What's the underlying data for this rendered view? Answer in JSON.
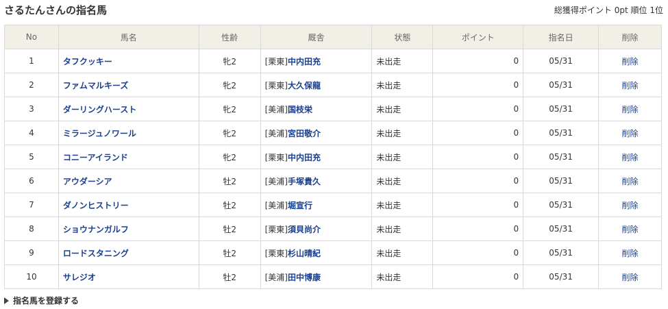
{
  "header": {
    "title": "さるたんさんの指名馬",
    "summary_label": "総獲得ポイント",
    "points": "0pt",
    "rank_label": "順位",
    "rank": "1位"
  },
  "table": {
    "columns": [
      "No",
      "馬名",
      "性齢",
      "厩舎",
      "状態",
      "ポイント",
      "指名日",
      "削除"
    ],
    "rows": [
      {
        "no": "1",
        "name": "タフクッキー",
        "sex_age": "牝2",
        "region": "[栗東]",
        "trainer": "中内田充",
        "status": "未出走",
        "point": "0",
        "date": "05/31",
        "delete": "削除"
      },
      {
        "no": "2",
        "name": "ファムマルキーズ",
        "sex_age": "牝2",
        "region": "[栗東]",
        "trainer": "大久保龍",
        "status": "未出走",
        "point": "0",
        "date": "05/31",
        "delete": "削除"
      },
      {
        "no": "3",
        "name": "ダーリングハースト",
        "sex_age": "牝2",
        "region": "[美浦]",
        "trainer": "国枝栄",
        "status": "未出走",
        "point": "0",
        "date": "05/31",
        "delete": "削除"
      },
      {
        "no": "4",
        "name": "ミラージュノワール",
        "sex_age": "牝2",
        "region": "[美浦]",
        "trainer": "宮田敬介",
        "status": "未出走",
        "point": "0",
        "date": "05/31",
        "delete": "削除"
      },
      {
        "no": "5",
        "name": "コニーアイランド",
        "sex_age": "牝2",
        "region": "[栗東]",
        "trainer": "中内田充",
        "status": "未出走",
        "point": "0",
        "date": "05/31",
        "delete": "削除"
      },
      {
        "no": "6",
        "name": "アウダーシア",
        "sex_age": "牡2",
        "region": "[美浦]",
        "trainer": "手塚貴久",
        "status": "未出走",
        "point": "0",
        "date": "05/31",
        "delete": "削除"
      },
      {
        "no": "7",
        "name": "ダノンヒストリー",
        "sex_age": "牡2",
        "region": "[美浦]",
        "trainer": "堀宣行",
        "status": "未出走",
        "point": "0",
        "date": "05/31",
        "delete": "削除"
      },
      {
        "no": "8",
        "name": "ショウナンガルフ",
        "sex_age": "牡2",
        "region": "[栗東]",
        "trainer": "須貝尚介",
        "status": "未出走",
        "point": "0",
        "date": "05/31",
        "delete": "削除"
      },
      {
        "no": "9",
        "name": "ロードスタニング",
        "sex_age": "牡2",
        "region": "[栗東]",
        "trainer": "杉山晴紀",
        "status": "未出走",
        "point": "0",
        "date": "05/31",
        "delete": "削除"
      },
      {
        "no": "10",
        "name": "サレジオ",
        "sex_age": "牡2",
        "region": "[美浦]",
        "trainer": "田中博康",
        "status": "未出走",
        "point": "0",
        "date": "05/31",
        "delete": "削除"
      }
    ]
  },
  "footer": {
    "register_link": "指名馬を登録する"
  },
  "colors": {
    "link": "#1a3f8f",
    "header_bg": "#f2efe6",
    "border": "#d9d9d9"
  }
}
